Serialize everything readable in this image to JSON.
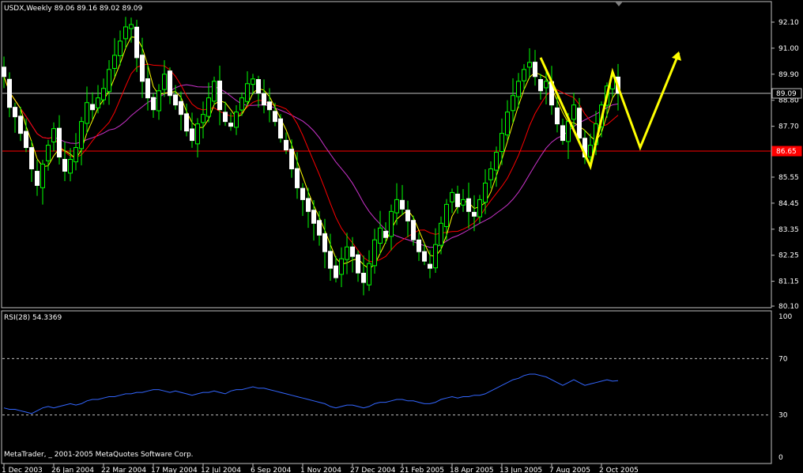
{
  "main": {
    "header": "USDX,Weekly  89.06 89.16 89.02 89.09",
    "price_ticks": [
      "92.10",
      "91.00",
      "89.90",
      "88.80",
      "87.70",
      "86.65",
      "85.55",
      "84.45",
      "83.35",
      "82.25",
      "81.15",
      "80.10"
    ],
    "current_price": "89.09",
    "level_price": "86.65",
    "colors": {
      "bull": "#00ff00",
      "bear": "#ffffff",
      "sma_fast": "#ffff00",
      "sma_mid": "#ff0000",
      "sma_slow": "#cc33cc",
      "level": "#ff0000",
      "annotation": "#ffff00",
      "rsi": "#3366ff"
    }
  },
  "rsi_panel": {
    "header": "RSI(28) 54.3369",
    "ticks": [
      "100",
      "70",
      "30",
      "0"
    ]
  },
  "footer": {
    "copyright": "MetaTrader, _ 2001-2005 MetaQuotes Software Corp."
  },
  "date_labels": [
    "1 Dec 2003",
    "26 Jan 2004",
    "22 Mar 2004",
    "17 May 2004",
    "12 Jul 2004",
    "6 Sep 2004",
    "1 Nov 2004",
    "27 Dec 2004",
    "21 Feb 2005",
    "18 Apr 2005",
    "13 Jun 2005",
    "7 Aug 2005",
    "2 Oct 2005"
  ],
  "chart_data": {
    "type": "candlestick",
    "title": "USDX,Weekly",
    "period": "Weekly",
    "ylim": [
      80.1,
      92.1
    ],
    "last_bar": {
      "open": 89.06,
      "high": 89.16,
      "low": 89.02,
      "close": 89.09
    },
    "horizontal_lines": [
      89.09,
      86.65
    ],
    "closes": [
      89.8,
      88.5,
      88.1,
      87.4,
      86.8,
      85.9,
      85.2,
      86.1,
      86.9,
      87.6,
      86.4,
      85.8,
      86.3,
      86.8,
      87.9,
      88.7,
      88.4,
      88.9,
      89.3,
      90.1,
      90.7,
      91.3,
      91.9,
      92.0,
      90.6,
      89.6,
      88.9,
      88.4,
      89.2,
      89.9,
      89.0,
      88.6,
      88.2,
      87.5,
      87.1,
      87.8,
      88.2,
      88.9,
      89.6,
      88.4,
      87.9,
      87.7,
      88.3,
      88.9,
      89.5,
      89.7,
      89.1,
      88.6,
      88.4,
      87.9,
      87.2,
      86.7,
      85.9,
      85.1,
      84.6,
      84.1,
      83.6,
      83.1,
      82.4,
      81.7,
      81.3,
      82.1,
      82.6,
      82.2,
      81.5,
      81.1,
      81.9,
      82.9,
      83.4,
      83.0,
      84.1,
      84.6,
      84.2,
      83.7,
      82.9,
      82.4,
      82.0,
      81.7,
      82.7,
      83.6,
      84.4,
      84.9,
      84.3,
      84.6,
      84.1,
      83.9,
      84.6,
      85.3,
      85.9,
      86.6,
      87.4,
      88.3,
      89.0,
      89.6,
      90.1,
      90.4,
      89.8,
      89.2,
      89.6,
      88.6,
      87.8,
      87.1,
      87.9,
      88.6,
      87.2,
      86.4,
      86.9,
      87.8,
      88.6,
      89.4,
      89.8,
      89.09
    ],
    "rsi": {
      "period": 28,
      "last_value": 54.3369,
      "levels": [
        30,
        70
      ],
      "ylim": [
        0,
        100
      ],
      "values": [
        35,
        34,
        34,
        33,
        32,
        31,
        33,
        35,
        36,
        35,
        36,
        37,
        38,
        37,
        38,
        40,
        41,
        41,
        42,
        43,
        43,
        44,
        45,
        45,
        46,
        46,
        47,
        48,
        48,
        47,
        46,
        47,
        46,
        45,
        44,
        45,
        46,
        46,
        47,
        46,
        45,
        47,
        48,
        48,
        49,
        50,
        49,
        49,
        48,
        47,
        46,
        45,
        44,
        43,
        42,
        41,
        40,
        39,
        38,
        36,
        35,
        36,
        37,
        37,
        36,
        35,
        36,
        38,
        39,
        39,
        40,
        41,
        41,
        40,
        40,
        39,
        38,
        38,
        39,
        41,
        42,
        43,
        42,
        43,
        43,
        44,
        44,
        45,
        47,
        49,
        51,
        53,
        55,
        56,
        58,
        59,
        59,
        58,
        57,
        55,
        53,
        51,
        53,
        55,
        53,
        51,
        52,
        53,
        54,
        55,
        54,
        54.34
      ]
    }
  }
}
